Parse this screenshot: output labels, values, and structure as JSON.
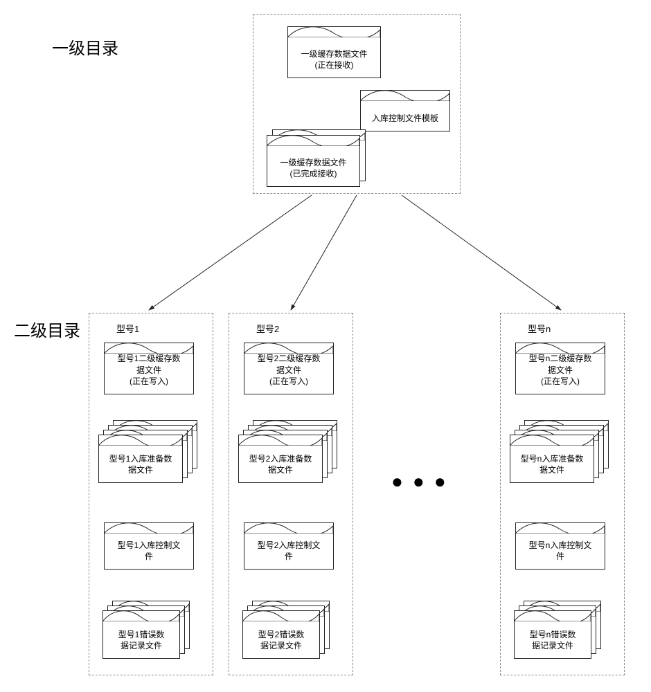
{
  "labels": {
    "level1": "一级目录",
    "level2": "二级目录"
  },
  "top": {
    "file_receiving_l1": "一级缓存数据文件",
    "file_receiving_l2": "(正在接收)",
    "template": "入库控制文件模板",
    "file_done_l1": "一级缓存数据文件",
    "file_done_l2": "(已完成接收)"
  },
  "columns": [
    {
      "title": "型号1",
      "cache_l1": "型号1二级缓存数",
      "cache_l2": "据文件",
      "cache_l3": "(正在写入)",
      "prep_l1": "型号1入库准备数",
      "prep_l2": "据文件",
      "ctrl_l1": "型号1入库控制文",
      "ctrl_l2": "件",
      "err_l1": "型号1错误数",
      "err_l2": "据记录文件"
    },
    {
      "title": "型号2",
      "cache_l1": "型号2二级缓存数",
      "cache_l2": "据文件",
      "cache_l3": "(正在写入)",
      "prep_l1": "型号2入库准备数",
      "prep_l2": "据文件",
      "ctrl_l1": "型号2入库控制文",
      "ctrl_l2": "件",
      "err_l1": "型号2错误数",
      "err_l2": "据记录文件"
    },
    {
      "title": "型号n",
      "cache_l1": "型号n二级缓存数",
      "cache_l2": "据文件",
      "cache_l3": "(正在写入)",
      "prep_l1": "型号n入库准备数",
      "prep_l2": "据文件",
      "ctrl_l1": "型号n入库控制文",
      "ctrl_l2": "件",
      "err_l1": "型号n错误数",
      "err_l2": "据记录文件"
    }
  ],
  "ellipsis": "●●●"
}
